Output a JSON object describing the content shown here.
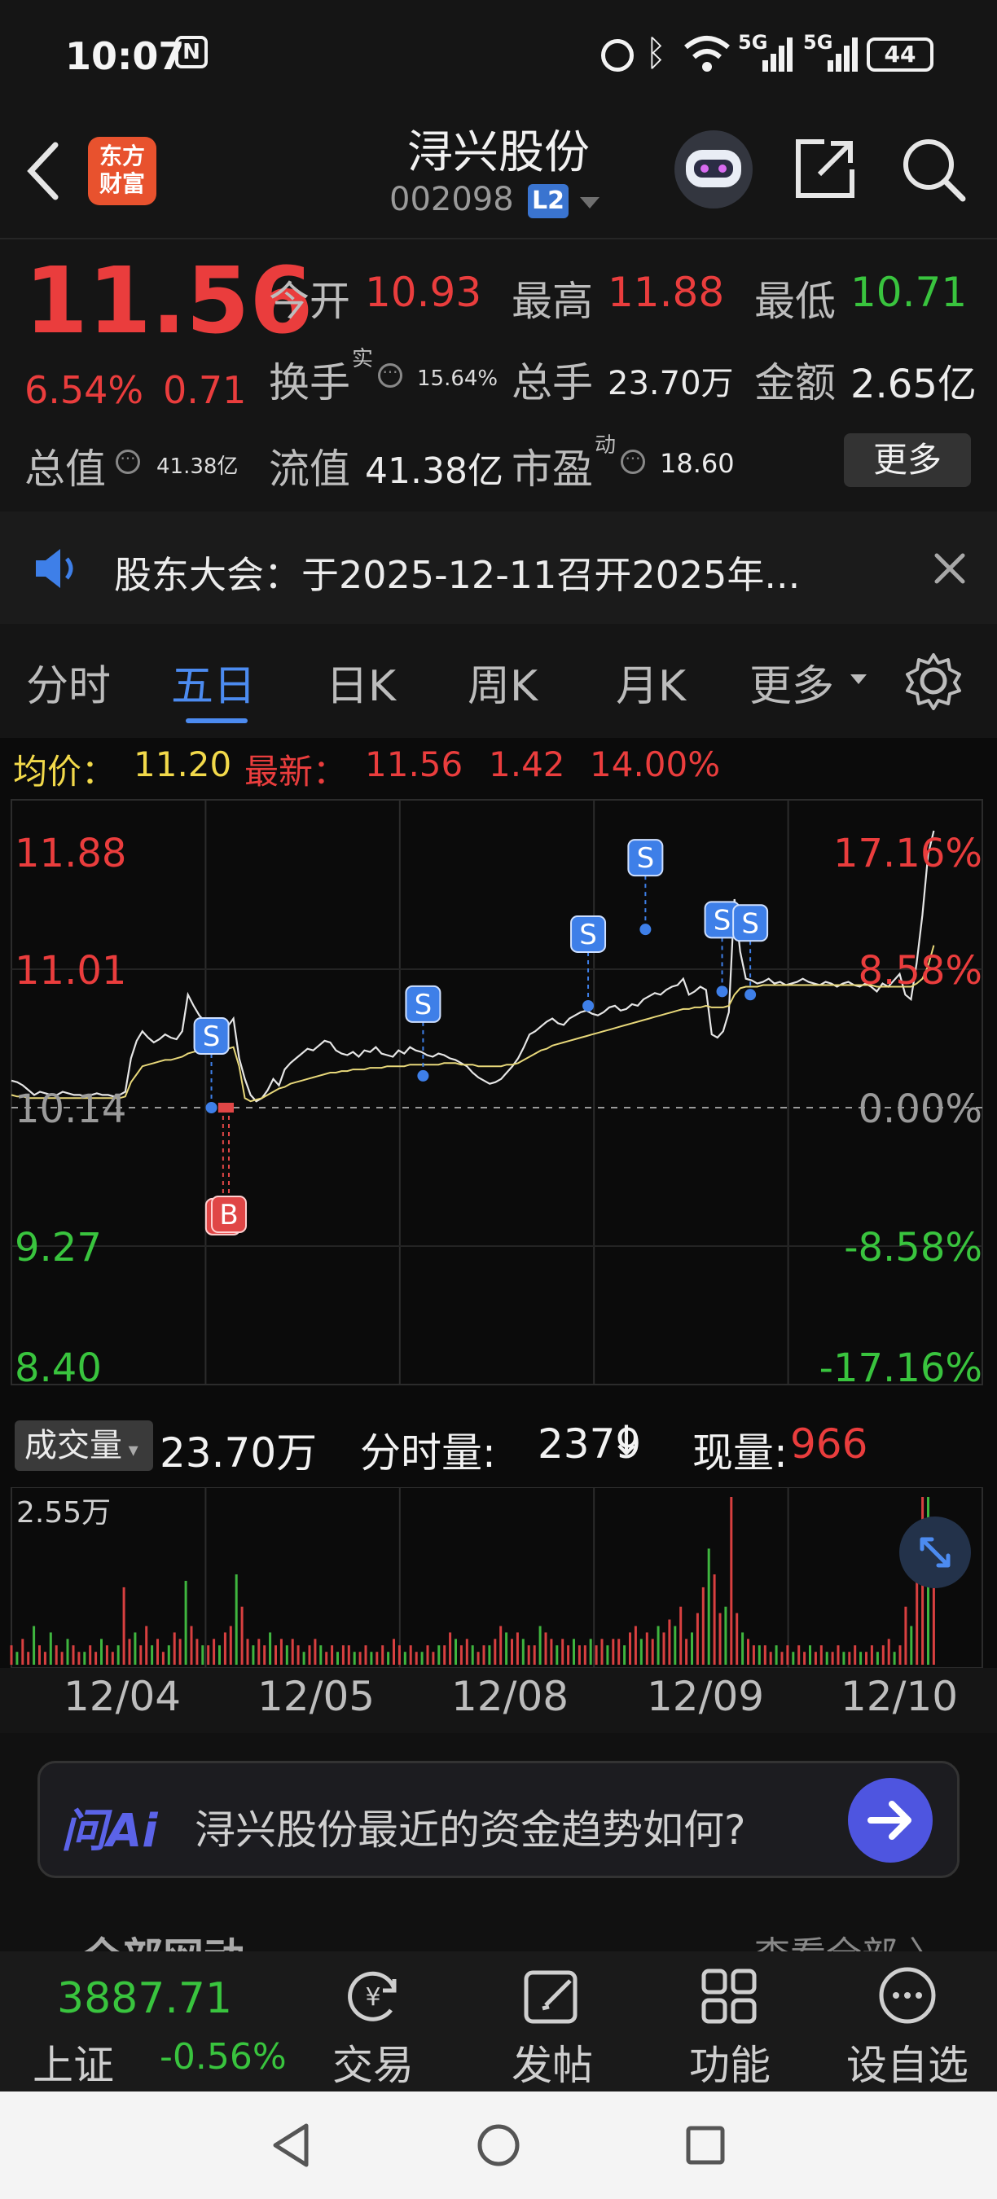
{
  "status": {
    "time": "10:07",
    "battery": "44",
    "signal1": "5G",
    "signal2": "5G"
  },
  "header": {
    "logo_line1": "东方",
    "logo_line2": "财富",
    "title": "浔兴股份",
    "code": "002098",
    "level_badge": "L2"
  },
  "quote": {
    "price": "11.56",
    "change_pct": "6.54%",
    "change_amt": "0.71",
    "open_label": "今开",
    "open": "10.93",
    "high_label": "最高",
    "high": "11.88",
    "low_label": "最低",
    "low": "10.71",
    "turnover_label": "换手",
    "turnover_sup": "实",
    "turnover": "15.64%",
    "volume_label": "总手",
    "volume": "23.70万",
    "amount_label": "金额",
    "amount": "2.65亿",
    "mktcap_label": "总值",
    "mktcap": "41.38亿",
    "float_label": "流值",
    "float_cap": "41.38亿",
    "pe_label": "市盈",
    "pe_sup": "动",
    "pe": "18.60",
    "more_button": "更多"
  },
  "notice": {
    "text": "股东大会：于2025-12-11召开2025年..."
  },
  "tabs": [
    "分时",
    "五日",
    "日K",
    "周K",
    "月K",
    "更多"
  ],
  "active_tab": "五日",
  "chart_info": {
    "avg_label": "均价：",
    "avg": "11.20",
    "latest_label": "最新：",
    "latest": "11.56",
    "change": "1.42",
    "change_pct": "14.00%"
  },
  "chart_data": {
    "type": "line",
    "x_dates": [
      "12/04",
      "12/05",
      "12/08",
      "12/09",
      "12/10"
    ],
    "y_left_ticks": [
      "11.88",
      "11.01",
      "10.14",
      "9.27",
      "8.40"
    ],
    "y_right_ticks": [
      "17.16%",
      "8.58%",
      "0.00%",
      "-8.58%",
      "-17.16%"
    ],
    "ylim": [
      8.4,
      11.88
    ],
    "prev_close": 10.14,
    "series": [
      {
        "values": [
          10.31,
          10.3,
          10.28,
          10.25,
          10.22,
          10.24,
          10.23,
          10.22,
          10.22,
          10.24,
          10.23,
          10.22,
          10.22,
          10.21,
          10.22,
          10.23,
          10.22,
          10.22,
          10.21,
          10.22,
          10.24,
          10.45,
          10.56,
          10.62,
          10.58,
          10.55,
          10.57,
          10.6,
          10.58,
          10.57,
          10.62,
          10.85,
          10.78,
          10.72,
          10.68,
          10.66,
          10.64,
          10.62,
          10.65,
          10.7,
          10.45,
          10.32,
          10.22,
          10.18,
          10.2,
          10.25,
          10.32,
          10.28,
          10.38,
          10.42,
          10.45,
          10.48,
          10.51,
          10.5,
          10.53,
          10.56,
          10.55,
          10.5,
          10.48,
          10.47,
          10.49,
          10.46,
          10.5,
          10.49,
          10.52,
          10.48,
          10.47,
          10.46,
          10.5,
          10.48,
          10.52,
          10.5,
          10.49,
          10.47,
          10.46,
          10.48,
          10.47,
          10.45,
          10.44,
          10.42,
          10.4,
          10.36,
          10.33,
          10.31,
          10.29,
          10.3,
          10.32,
          10.36,
          10.4,
          10.45,
          10.52,
          10.6,
          10.62,
          10.65,
          10.68,
          10.7,
          10.67,
          10.66,
          10.7,
          10.72,
          10.74,
          10.75,
          10.73,
          10.72,
          10.74,
          10.77,
          10.78,
          10.75,
          10.76,
          10.79,
          10.78,
          10.82,
          10.84,
          10.86,
          10.85,
          10.88,
          10.9,
          10.91,
          10.95,
          10.85,
          10.87,
          10.9,
          10.88,
          10.6,
          10.58,
          10.62,
          10.74,
          11.45,
          11.12,
          10.95,
          10.94,
          10.92,
          10.93,
          10.95,
          10.92,
          10.93,
          10.91,
          10.92,
          10.93,
          10.95,
          10.93,
          10.92,
          10.91,
          10.93,
          10.92,
          10.9,
          10.92,
          10.93,
          10.91,
          10.9,
          10.92,
          10.9,
          10.87,
          10.92,
          10.9,
          10.94,
          10.98,
          10.85,
          10.82,
          11.05,
          11.35,
          11.73,
          11.88
        ],
        "color": "#e6e6e6"
      },
      {
        "values": [
          10.22,
          10.21,
          10.21,
          10.2,
          10.2,
          10.2,
          10.2,
          10.2,
          10.2,
          10.2,
          10.2,
          10.2,
          10.2,
          10.2,
          10.2,
          10.2,
          10.2,
          10.2,
          10.2,
          10.2,
          10.21,
          10.3,
          10.35,
          10.4,
          10.41,
          10.42,
          10.43,
          10.44,
          10.44,
          10.45,
          10.46,
          10.48,
          10.49,
          10.5,
          10.5,
          10.5,
          10.51,
          10.51,
          10.51,
          10.52,
          10.4,
          10.2,
          10.18,
          10.19,
          10.2,
          10.22,
          10.24,
          10.26,
          10.27,
          10.29,
          10.3,
          10.31,
          10.32,
          10.33,
          10.34,
          10.35,
          10.36,
          10.36,
          10.37,
          10.37,
          10.38,
          10.38,
          10.38,
          10.39,
          10.39,
          10.39,
          10.4,
          10.4,
          10.4,
          10.4,
          10.41,
          10.41,
          10.41,
          10.41,
          10.41,
          10.41,
          10.42,
          10.42,
          10.42,
          10.41,
          10.41,
          10.41,
          10.4,
          10.4,
          10.4,
          10.4,
          10.4,
          10.41,
          10.41,
          10.42,
          10.44,
          10.46,
          10.48,
          10.5,
          10.51,
          10.53,
          10.54,
          10.55,
          10.56,
          10.57,
          10.58,
          10.59,
          10.6,
          10.61,
          10.62,
          10.63,
          10.64,
          10.65,
          10.66,
          10.67,
          10.68,
          10.69,
          10.7,
          10.71,
          10.72,
          10.73,
          10.74,
          10.75,
          10.76,
          10.76,
          10.77,
          10.77,
          10.78,
          10.77,
          10.77,
          10.77,
          10.78,
          10.85,
          10.89,
          10.9,
          10.9,
          10.9,
          10.91,
          10.91,
          10.91,
          10.91,
          10.91,
          10.91,
          10.91,
          10.91,
          10.91,
          10.91,
          10.91,
          10.91,
          10.91,
          10.91,
          10.91,
          10.91,
          10.91,
          10.91,
          10.91,
          10.91,
          10.9,
          10.9,
          10.9,
          10.9,
          10.9,
          10.9,
          10.9,
          10.92,
          10.95,
          11.03,
          11.16
        ],
        "color": "#e8d87a"
      }
    ],
    "markers": [
      {
        "label": "S",
        "x": 0.206,
        "price": 10.14
      },
      {
        "label": "B",
        "x": 0.218,
        "price": 10.14
      },
      {
        "label": "B",
        "x": 0.224,
        "price": 10.14
      },
      {
        "label": "S",
        "x": 0.424,
        "price": 10.34
      },
      {
        "label": "S",
        "x": 0.594,
        "price": 10.78
      },
      {
        "label": "S",
        "x": 0.653,
        "price": 11.26
      },
      {
        "label": "S",
        "x": 0.732,
        "price": 10.87
      },
      {
        "label": "S",
        "x": 0.761,
        "price": 10.85
      }
    ]
  },
  "volume_panel": {
    "selector": "成交量",
    "total": "23.70万",
    "minute_label": "分时量:",
    "minute": "2379",
    "current_label": "现量:",
    "current": "966",
    "ymax": "2.55万"
  },
  "volume_data": [
    3,
    2,
    4,
    2,
    6,
    3,
    2,
    5,
    3,
    2,
    4,
    3,
    2,
    2,
    3,
    2,
    4,
    3,
    2,
    3,
    12,
    4,
    5,
    3,
    6,
    3,
    4,
    2,
    3,
    5,
    4,
    13,
    6,
    4,
    3,
    3,
    4,
    3,
    5,
    6,
    14,
    9,
    4,
    3,
    4,
    3,
    5,
    3,
    4,
    3,
    4,
    3,
    2,
    3,
    4,
    3,
    2,
    3,
    2,
    3,
    3,
    2,
    2,
    3,
    2,
    2,
    3,
    2,
    4,
    3,
    2,
    3,
    2,
    2,
    3,
    2,
    3,
    3,
    5,
    4,
    3,
    4,
    3,
    2,
    3,
    3,
    4,
    6,
    5,
    4,
    5,
    4,
    3,
    3,
    6,
    5,
    4,
    3,
    4,
    3,
    4,
    3,
    3,
    4,
    3,
    4,
    3,
    4,
    4,
    3,
    5,
    6,
    4,
    5,
    4,
    6,
    5,
    7,
    6,
    9,
    4,
    5,
    8,
    12,
    18,
    14,
    8,
    9,
    26,
    8,
    5,
    4,
    3,
    3,
    3,
    2,
    3,
    2,
    3,
    2,
    3,
    2,
    3,
    2,
    3,
    2,
    2,
    3,
    2,
    2,
    3,
    2,
    2,
    3,
    2,
    3,
    4,
    2,
    3,
    9,
    6,
    14,
    26,
    26,
    18
  ],
  "x_labels": [
    "12/04",
    "12/05",
    "12/08",
    "12/09",
    "12/10"
  ],
  "ai": {
    "brand": "问Ai",
    "prompt": "浔兴股份最近的资金趋势如何?"
  },
  "partial": {
    "left": "全部网动",
    "right": "查看全部 〉"
  },
  "bottom_nav": {
    "index_value": "3887.71",
    "index_name": "上证",
    "index_change": "-0.56%",
    "items": [
      "交易",
      "发帖",
      "功能",
      "设自选"
    ]
  }
}
